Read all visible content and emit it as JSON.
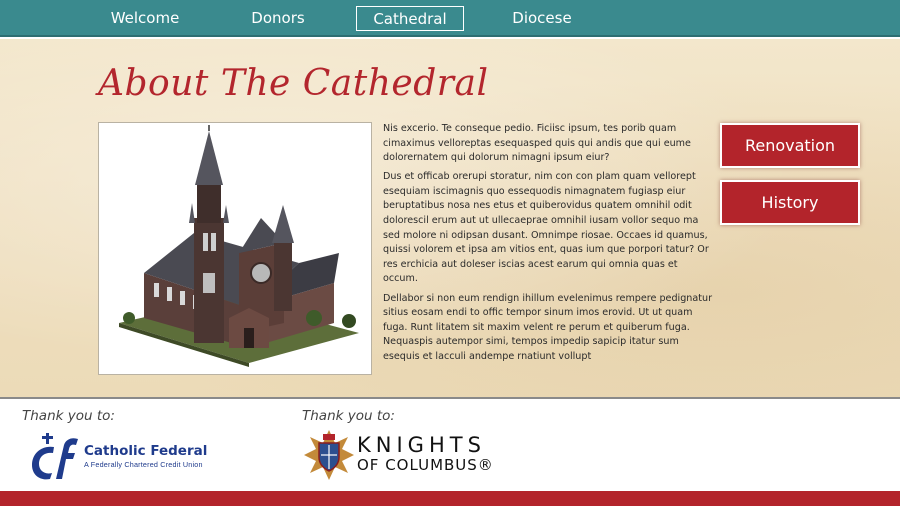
{
  "nav": {
    "items": [
      {
        "label": "Welcome"
      },
      {
        "label": "Donors"
      },
      {
        "label": "Cathedral",
        "active": true
      },
      {
        "label": "Diocese"
      }
    ]
  },
  "main": {
    "title": "About The Cathedral",
    "paragraphs": [
      "Nis excerio. Te conseque pedio. Ficiisc ipsum, tes porib quam cimaximus velloreptas esequasped quis qui andis que qui eume dolorernatem qui dolorum nimagni ipsum eiur?",
      "Dus et officab orerupi storatur, nim con con plam quam vellorept esequiam iscimagnis quo essequodis nimagnatem fugiasp eiur  beruptatibus nosa nes etus et quiberovidus quatem omnihil odit dolorescil erum aut ut ullecaeprae omnihil iusam vollor sequo ma sed molore ni odipsan dusant. Omnimpe riosae. Occaes id quamus, quissi volorem et ipsa am vitios ent, quas ium que porpori tatur? Or res erchicia aut doleser iscias acest earum qui omnia quas et occum.",
      "Dellabor si non eum rendign ihillum evelenimus rempere pedignatur sitius eosam endi to offic tempor sinum imos erovid. Ut ut quam fuga. Runt litatem sit maxim velent re perum et quiberum fuga. Nequaspis autempor simi, tempos impedip sapicip itatur sum esequis et lacculi andempe rnatiunt vollupt"
    ],
    "buttons": {
      "renovation": "Renovation",
      "history": "History"
    }
  },
  "footer": {
    "thanks_left": "Thank you to:",
    "thanks_right": "Thank you to:",
    "sponsor1": {
      "name": "Catholic Federal",
      "subtitle": "A Federally Chartered Credit Union"
    },
    "sponsor2": {
      "line1": "KNIGHTS",
      "line2": "OF COLUMBUS®"
    }
  },
  "colors": {
    "nav": "#3a8a8e",
    "accent_red": "#b3242b",
    "parchment": "#efdfbf",
    "cf_blue": "#1f3b8c"
  },
  "icons": [
    "cathedral-image",
    "catholic-federal-logo",
    "knights-of-columbus-emblem"
  ]
}
